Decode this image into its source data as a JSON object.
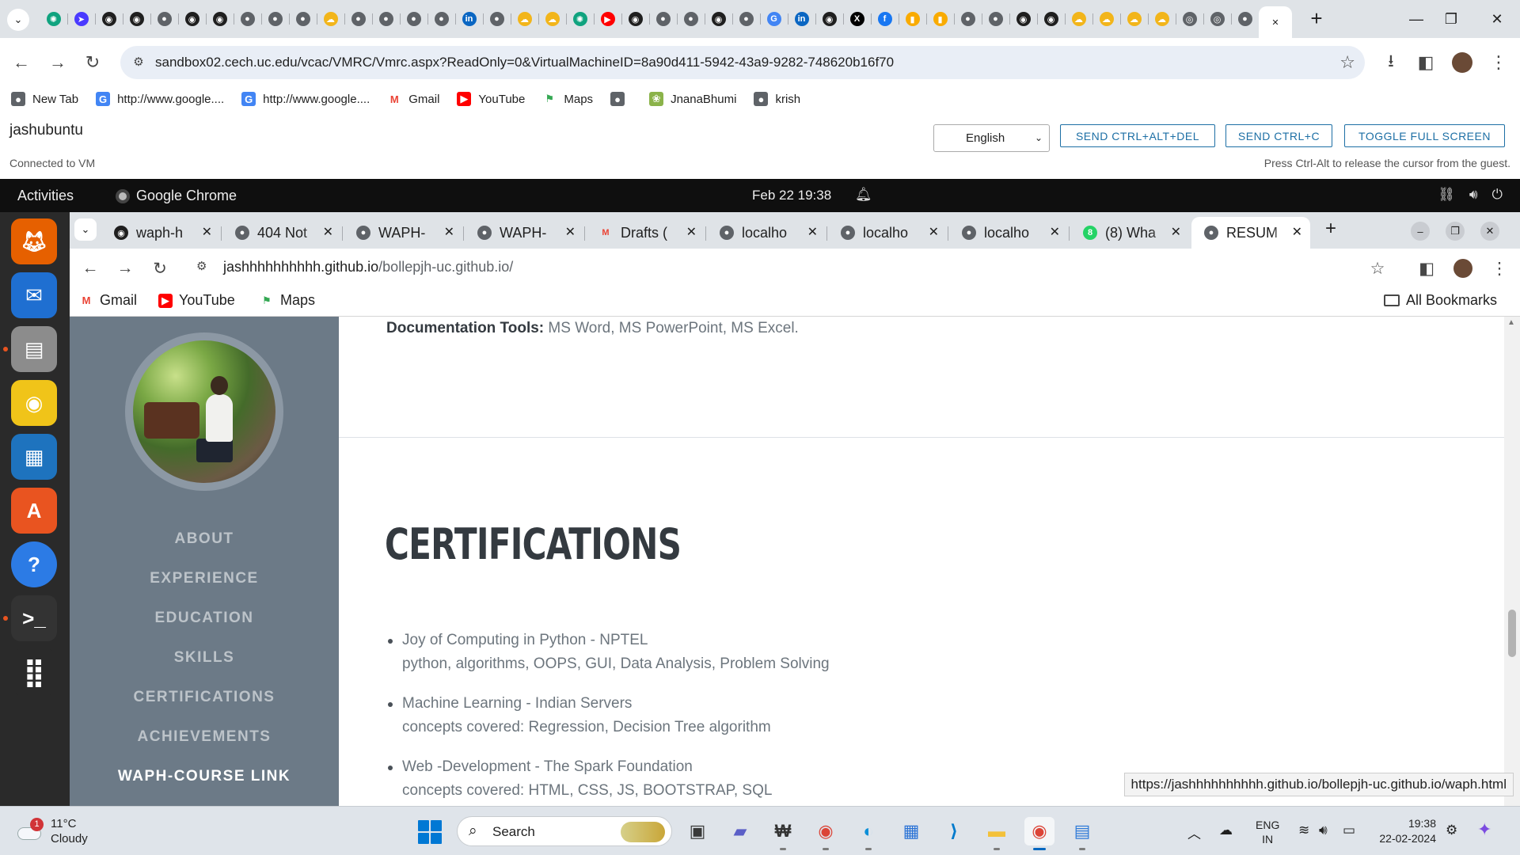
{
  "outer_browser": {
    "tab_icons": [
      "chatgpt-icon",
      "arrow-icon",
      "github-icon",
      "github-icon",
      "globe-icon",
      "github-icon",
      "github-icon",
      "globe-icon",
      "globe-icon",
      "globe-icon",
      "weather-icon",
      "globe-icon",
      "globe-icon",
      "globe-icon",
      "globe-icon",
      "linkedin-icon",
      "globe-icon",
      "weather-icon",
      "weather-icon",
      "chatgpt-icon",
      "youtube-icon",
      "github-icon",
      "globe-icon",
      "globe-icon",
      "github-icon",
      "globe-icon",
      "google-icon",
      "linkedin-icon",
      "github-icon",
      "x-icon",
      "facebook-icon",
      "analytics-icon",
      "analytics-icon",
      "globe-icon",
      "globe-icon",
      "github-icon",
      "github-icon",
      "weather-icon",
      "weather-icon",
      "weather-icon",
      "weather-icon",
      "chrome-icon",
      "chrome-icon",
      "globe-icon",
      "close-icon"
    ],
    "url": "sandbox02.cech.uc.edu/vcac/VMRC/Vmrc.aspx?ReadOnly=0&VirtualMachineID=8a90d411-5942-43a9-9282-748620b16f70",
    "bookmarks": [
      {
        "label": "New Tab",
        "icon": "globe-icon"
      },
      {
        "label": "http://www.google....",
        "icon": "google-icon"
      },
      {
        "label": "http://www.google....",
        "icon": "google-icon"
      },
      {
        "label": "Gmail",
        "icon": "gmail-icon"
      },
      {
        "label": "YouTube",
        "icon": "youtube-icon"
      },
      {
        "label": "Maps",
        "icon": "maps-icon"
      },
      {
        "label": "",
        "icon": "globe-icon"
      },
      {
        "label": "JnanaBhumi",
        "icon": "jnanabhumi-icon"
      },
      {
        "label": "krish",
        "icon": "globe-icon"
      }
    ]
  },
  "vmrc": {
    "vm_name": "jashubuntu",
    "status": "Connected to VM",
    "language": "English",
    "btn_ctrl_alt_del": "SEND CTRL+ALT+DEL",
    "btn_ctrl_c": "SEND CTRL+C",
    "btn_fullscreen": "TOGGLE FULL SCREEN",
    "hint": "Press Ctrl-Alt to release the cursor from the guest."
  },
  "guest": {
    "activities": "Activities",
    "app_name": "Google Chrome",
    "clock": "Feb 22  19:38",
    "dock": [
      {
        "name": "firefox-icon",
        "color": "#e66000"
      },
      {
        "name": "thunderbird-icon",
        "color": "#1f6fd1"
      },
      {
        "name": "files-icon",
        "color": "#8c8c8c"
      },
      {
        "name": "rhythmbox-icon",
        "color": "#f0c419"
      },
      {
        "name": "writer-icon",
        "color": "#1e73be"
      },
      {
        "name": "app-center-icon",
        "color": "#e95420"
      },
      {
        "name": "help-icon",
        "color": "#2c7be5"
      },
      {
        "name": "terminal-icon",
        "color": "#333333"
      },
      {
        "name": "show-apps-icon",
        "color": "#2a2a2a"
      }
    ]
  },
  "inner_browser": {
    "tabs": [
      {
        "title": "waph-h",
        "icon": "github-icon"
      },
      {
        "title": "404 Not",
        "icon": "globe-icon"
      },
      {
        "title": "WAPH-",
        "icon": "globe-icon"
      },
      {
        "title": "WAPH-",
        "icon": "globe-icon"
      },
      {
        "title": "Drafts (",
        "icon": "gmail-icon"
      },
      {
        "title": "localho",
        "icon": "globe-icon"
      },
      {
        "title": "localho",
        "icon": "globe-icon"
      },
      {
        "title": "localho",
        "icon": "globe-icon"
      },
      {
        "title": "(8) Wha",
        "icon": "whatsapp-icon"
      },
      {
        "title": "RESUM",
        "icon": "globe-icon"
      }
    ],
    "url_host": "jashhhhhhhhhh.github.io",
    "url_path": "/bollepjh-uc.github.io/",
    "bookmarks": [
      {
        "label": "Gmail",
        "icon": "gmail-icon"
      },
      {
        "label": "YouTube",
        "icon": "youtube-icon"
      },
      {
        "label": "Maps",
        "icon": "maps-icon"
      }
    ],
    "all_bookmarks": "All Bookmarks"
  },
  "page": {
    "doc_tools_label": "Documentation Tools:",
    "doc_tools_value": " MS Word, MS PowerPoint, MS Excel.",
    "nav": [
      "ABOUT",
      "EXPERIENCE",
      "EDUCATION",
      "SKILLS",
      "CERTIFICATIONS",
      "ACHIEVEMENTS",
      "WAPH-COURSE LINK"
    ],
    "cert_heading": "CERTIFICATIONS",
    "certifications": [
      {
        "title": "Joy of Computing in Python - NPTEL",
        "detail": "python, algorithms, OOPS, GUI, Data Analysis, Problem Solving"
      },
      {
        "title": "Machine Learning - Indian Servers",
        "detail": "concepts covered: Regression, Decision Tree algorithm"
      },
      {
        "title": "Web -Development - The Spark Foundation",
        "detail": "concepts covered: HTML, CSS, JS, BOOTSTRAP, SQL"
      }
    ],
    "status_url": "https://jashhhhhhhhhh.github.io/bollepjh-uc.github.io/waph.html"
  },
  "taskbar": {
    "weather_temp": "11°C",
    "weather_desc": "Cloudy",
    "weather_badge": "1",
    "search": "Search",
    "apps": [
      {
        "name": "task-view-icon",
        "color": "#3a3a3a"
      },
      {
        "name": "teams-icon",
        "color": "#5b5fc7"
      },
      {
        "name": "widgets-app-icon",
        "color": "#333333"
      },
      {
        "name": "chrome-icon",
        "color": "#db4437"
      },
      {
        "name": "edge-icon",
        "color": "#0c8fd8"
      },
      {
        "name": "store-icon",
        "color": "#2b73d6"
      },
      {
        "name": "vscode-icon",
        "color": "#007acc"
      },
      {
        "name": "file-explorer-icon",
        "color": "#f3c13a"
      },
      {
        "name": "chrome-profile-icon",
        "color": "#db4437"
      },
      {
        "name": "notepad-icon",
        "color": "#2f7ad8"
      }
    ],
    "lang_line1": "ENG",
    "lang_line2": "IN",
    "time": "19:38",
    "date": "22-02-2024"
  }
}
